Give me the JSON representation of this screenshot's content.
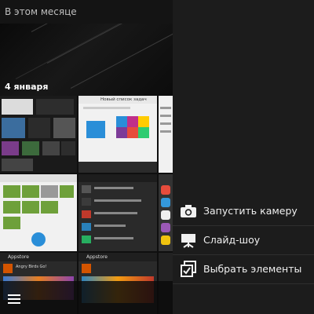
{
  "gallery": {
    "section_title": "В этом месяце",
    "date_label": "4 января",
    "thumb_new_list_title": "Новый список задач",
    "thumb_appstore_1": "Appstore",
    "thumb_appstore_2": "Appstore",
    "thumb_angry_birds": "Angry Birds Go!"
  },
  "menu": {
    "items": [
      {
        "label": "Запустить камеру",
        "icon": "camera-icon"
      },
      {
        "label": "Слайд-шоу",
        "icon": "slideshow-icon"
      },
      {
        "label": "Выбрать элементы",
        "icon": "select-items-icon"
      }
    ]
  },
  "nav": {
    "menu_icon": "hamburger-menu-icon"
  },
  "colors": {
    "background": "#1c1c1c",
    "text": "#f0f0f0",
    "accent_blue": "#2a8ed8"
  }
}
